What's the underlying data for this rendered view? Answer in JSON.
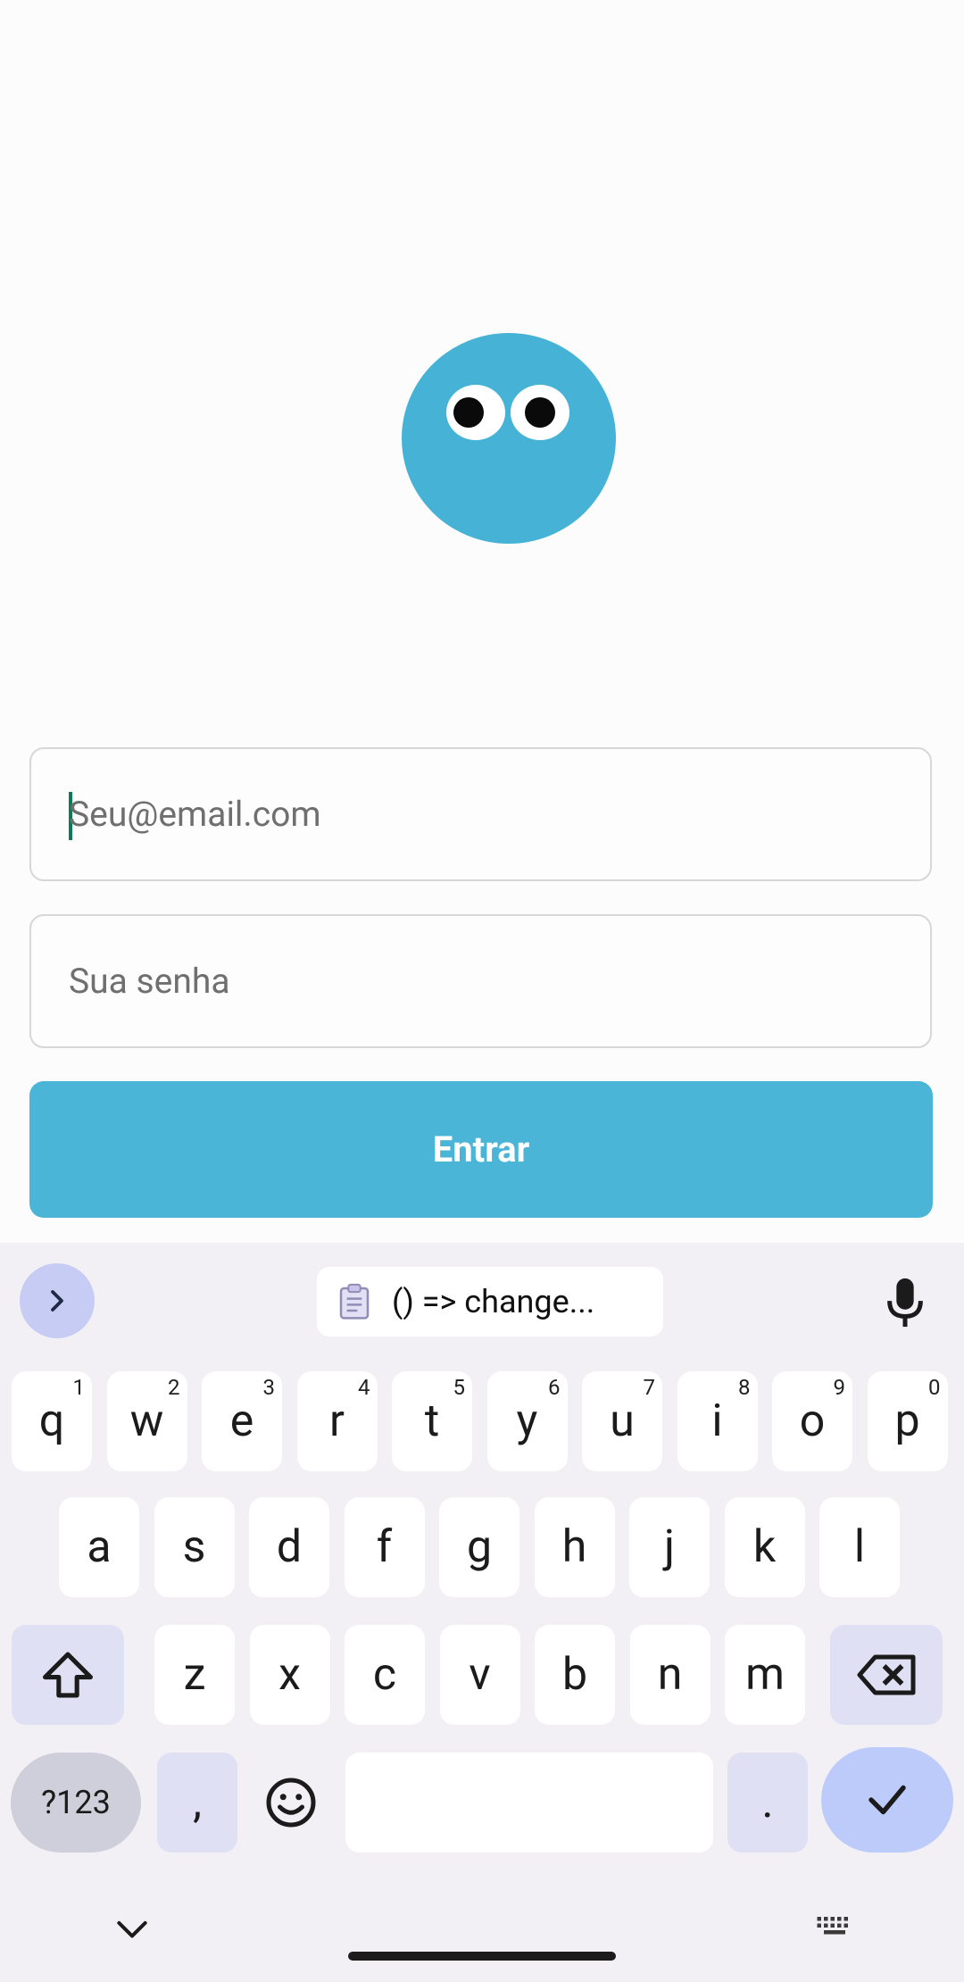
{
  "login": {
    "email_placeholder": "Seu@email.com",
    "password_placeholder": "Sua senha",
    "submit_label": "Entrar"
  },
  "keyboard": {
    "clipboard_suggestion": "() => change...",
    "row1": [
      {
        "key": "q",
        "sup": "1"
      },
      {
        "key": "w",
        "sup": "2"
      },
      {
        "key": "e",
        "sup": "3"
      },
      {
        "key": "r",
        "sup": "4"
      },
      {
        "key": "t",
        "sup": "5"
      },
      {
        "key": "y",
        "sup": "6"
      },
      {
        "key": "u",
        "sup": "7"
      },
      {
        "key": "i",
        "sup": "8"
      },
      {
        "key": "o",
        "sup": "9"
      },
      {
        "key": "p",
        "sup": "0"
      }
    ],
    "row2": [
      "a",
      "s",
      "d",
      "f",
      "g",
      "h",
      "j",
      "k",
      "l"
    ],
    "row3": [
      "z",
      "x",
      "c",
      "v",
      "b",
      "n",
      "m"
    ],
    "symbols_label": "?123",
    "comma": ",",
    "period": "."
  },
  "colors": {
    "brand": "#46b3d6",
    "button": "#4ab5d6",
    "keyboard_bg": "#f2f0f4",
    "enter_key": "#bccbf9"
  }
}
